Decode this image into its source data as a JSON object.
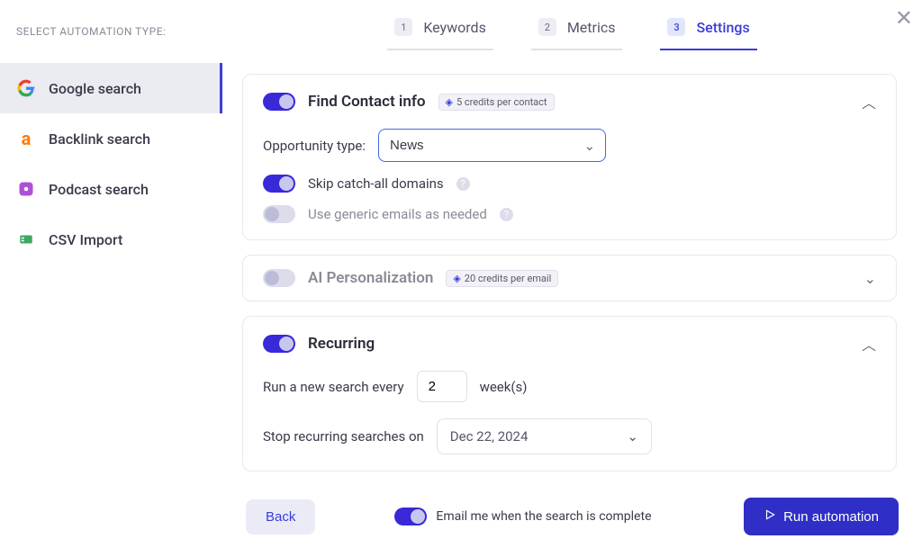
{
  "sidebar": {
    "title": "SELECT AUTOMATION TYPE:",
    "items": [
      {
        "label": "Google search"
      },
      {
        "label": "Backlink search"
      },
      {
        "label": "Podcast search"
      },
      {
        "label": "CSV Import"
      }
    ]
  },
  "steps": [
    {
      "num": "1",
      "label": "Keywords"
    },
    {
      "num": "2",
      "label": "Metrics"
    },
    {
      "num": "3",
      "label": "Settings"
    }
  ],
  "sections": {
    "find_contact": {
      "title": "Find Contact info",
      "badge": "5 credits per contact",
      "opportunity_label": "Opportunity type:",
      "opportunity_value": "News",
      "skip_catchall": "Skip catch-all domains",
      "generic_emails": "Use generic emails as needed"
    },
    "ai_personalization": {
      "title": "AI Personalization",
      "badge": "20 credits per email"
    },
    "recurring": {
      "title": "Recurring",
      "run_prefix": "Run a new search every",
      "run_value": "2",
      "run_suffix": "week(s)",
      "stop_label": "Stop recurring searches on",
      "stop_date": "Dec 22, 2024"
    }
  },
  "footer": {
    "back": "Back",
    "email_opt": "Email me when the search is complete",
    "run": "Run automation"
  }
}
